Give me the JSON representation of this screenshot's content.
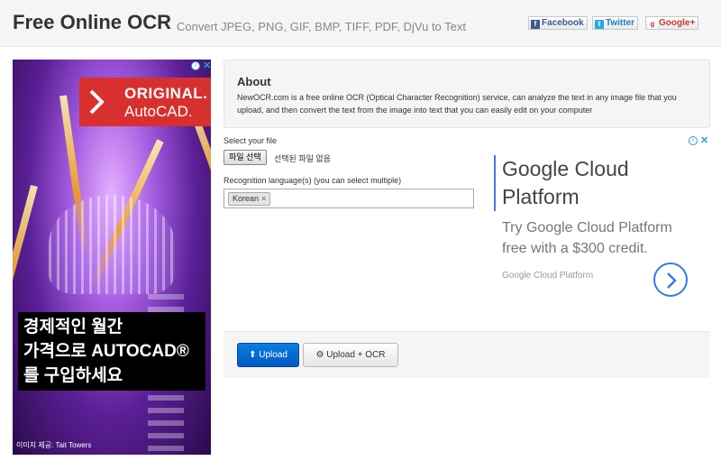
{
  "header": {
    "title": "Free Online OCR",
    "tagline": "Convert JPEG, PNG, GIF, BMP, TIFF, PDF, DjVu to Text"
  },
  "left_ad": {
    "badge_line1": "ORIGINAL.",
    "badge_line2": "AutoCAD.",
    "headline_line1": "경제적인 월간",
    "headline_line2": "가격으로 AUTOCAD®",
    "headline_line3": "를 구입하세요",
    "credit": "이미지 제공: Tait Towers",
    "info_icon": "info-icon",
    "close_icon": "close-icon"
  },
  "about": {
    "heading": "About",
    "text": "NewOCR.com is a free online OCR (Optical Character Recognition) service, can analyze the text in any image file that you upload, and then convert the text from the image into text that you can easily edit on your computer"
  },
  "form": {
    "file_label": "Select your file",
    "file_button": "파일 선택",
    "file_status": "선택된 파일 없음",
    "lang_label": "Recognition language(s) (you can select multiple)",
    "selected_language": "Korean",
    "remove_symbol": "×"
  },
  "google_ad": {
    "headline": "Google Cloud Platform",
    "description": "Try Google Cloud Platform free with a $300 credit.",
    "source": "Google Cloud Platform"
  },
  "actions": {
    "upload_label": "Upload",
    "upload_ocr_label": "Upload + OCR"
  },
  "share": {
    "facebook": "Facebook",
    "twitter": "Twitter",
    "google": "Google+"
  },
  "colors": {
    "primary_button": "#0a6fd6",
    "ad_red": "#d8302f",
    "google_blue": "#3b78e7"
  }
}
